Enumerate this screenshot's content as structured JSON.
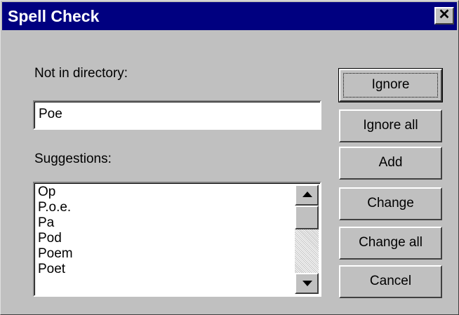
{
  "window": {
    "title": "Spell Check",
    "close_glyph": "✕"
  },
  "not_in_directory": {
    "label": "Not in directory:",
    "value": "Poe"
  },
  "suggestions": {
    "label": "Suggestions:",
    "items": [
      "Op",
      "P.o.e.",
      "Pa",
      "Pod",
      "Poem",
      "Poet"
    ]
  },
  "buttons": {
    "ignore": "Ignore",
    "ignore_all": "Ignore all",
    "add": "Add",
    "change": "Change",
    "change_all": "Change all",
    "cancel": "Cancel"
  },
  "colors": {
    "titlebar": "#000080",
    "face": "#c0c0c0"
  }
}
